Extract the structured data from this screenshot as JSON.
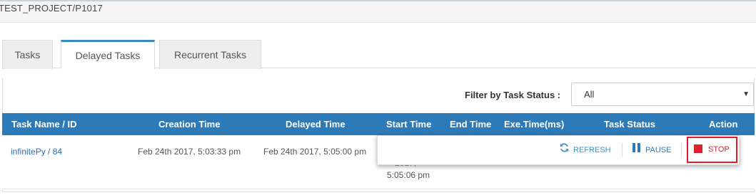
{
  "breadcrumb": "TEST_PROJECT/P1017",
  "tabs": [
    {
      "label": "Tasks",
      "active": false
    },
    {
      "label": "Delayed Tasks",
      "active": true
    },
    {
      "label": "Recurrent Tasks",
      "active": false
    }
  ],
  "filter": {
    "label": "Filter by Task Status :",
    "selected": "All"
  },
  "table": {
    "headers": [
      "Task Name / ID",
      "Creation Time",
      "Delayed Time",
      "Start Time",
      "End Time",
      "Exe.Time(ms)",
      "Task Status",
      "Action"
    ],
    "rows": [
      {
        "task_name": "infinitePy / 84",
        "creation_time": "Feb 24th 2017, 5:03:33 pm",
        "delayed_time": "Feb 24th 2017, 5:05:00 pm",
        "start_time_partial": "2017,",
        "start_time_time": "5:05:06 pm"
      }
    ]
  },
  "actions": {
    "refresh": "REFRESH",
    "pause": "PAUSE",
    "stop": "STOP"
  },
  "colors": {
    "header_bg": "#2c7ab7",
    "active_tab_accent": "#3b8ac4",
    "stop_red": "#d9232e",
    "refresh_blue": "#3a93c9",
    "link_blue": "#2a6db0"
  }
}
